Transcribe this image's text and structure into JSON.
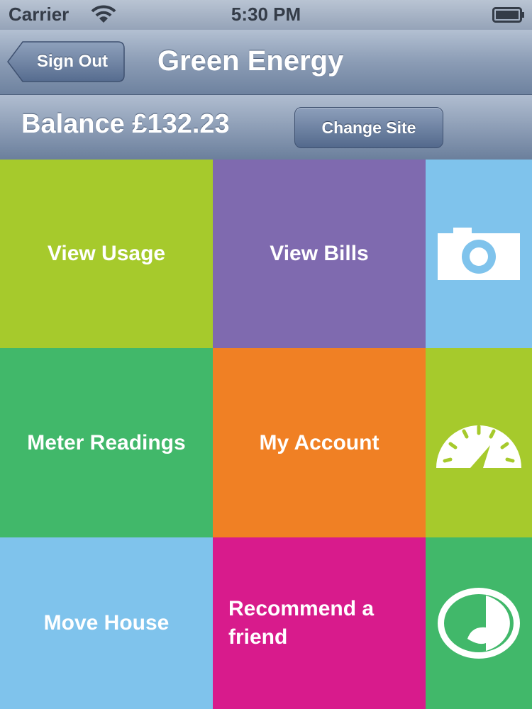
{
  "status_bar": {
    "carrier": "Carrier",
    "time": "5:30 PM",
    "wifi_icon": "wifi-icon",
    "battery_icon": "battery-icon"
  },
  "nav": {
    "back_label": "Sign Out",
    "title": "Green Energy"
  },
  "balance": {
    "text": "Balance £132.23",
    "change_site_label": "Change Site"
  },
  "tiles": {
    "view_usage": {
      "label": "View Usage",
      "color": "#a6ca2c"
    },
    "view_bills": {
      "label": "View Bills",
      "color": "#7f6aaf"
    },
    "camera": {
      "icon": "camera-icon",
      "color": "#7fc3ec"
    },
    "meter_readings": {
      "label": "Meter Readings",
      "color": "#41b86a"
    },
    "my_account": {
      "label": "My Account",
      "color": "#f08024"
    },
    "gauge": {
      "icon": "gauge-icon",
      "color": "#a6ca2c"
    },
    "move_house": {
      "label": "Move House",
      "color": "#7fc3ec"
    },
    "recommend": {
      "label": "Recommend a friend",
      "color": "#d81b8c"
    },
    "logo": {
      "icon": "logo-icon",
      "color": "#41b86a"
    }
  }
}
